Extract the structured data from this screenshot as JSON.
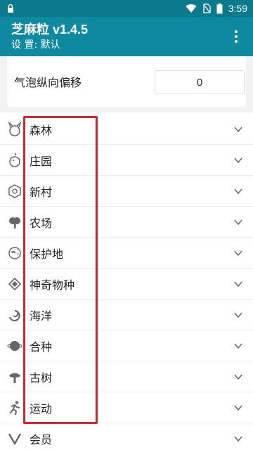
{
  "status_bar": {
    "time": "3:59"
  },
  "app_bar": {
    "title": "芝麻粒 v1.4.5",
    "subtitle": "设 置: 默认"
  },
  "setting": {
    "label": "气泡纵向偏移",
    "value": "0"
  },
  "menu_items": [
    {
      "label": "森林",
      "icon": "forest-icon"
    },
    {
      "label": "庄园",
      "icon": "chick-icon"
    },
    {
      "label": "新村",
      "icon": "village-icon"
    },
    {
      "label": "农场",
      "icon": "farm-tree-icon"
    },
    {
      "label": "保护地",
      "icon": "globe-icon"
    },
    {
      "label": "神奇物种",
      "icon": "diamond-icon"
    },
    {
      "label": "海洋",
      "icon": "wave-icon"
    },
    {
      "label": "合种",
      "icon": "planet-icon"
    },
    {
      "label": "古树",
      "icon": "old-tree-icon"
    },
    {
      "label": "运动",
      "icon": "runner-icon"
    },
    {
      "label": "会员",
      "icon": "member-icon"
    }
  ],
  "colors": {
    "status_bar": "#0a7a8c",
    "app_bar": "#0d8a9f",
    "highlight": "#d8232a"
  }
}
